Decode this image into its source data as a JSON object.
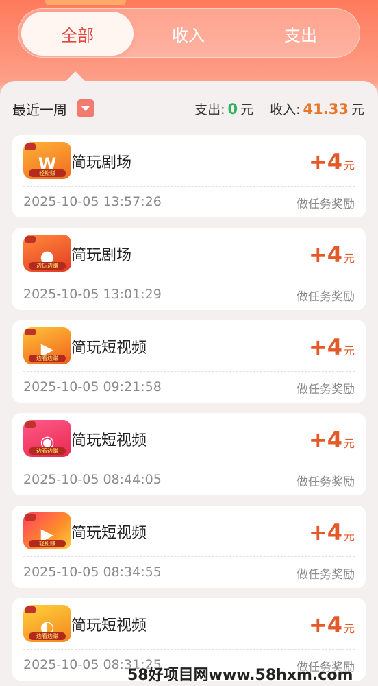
{
  "tabs": [
    {
      "label": "全部",
      "active": true
    },
    {
      "label": "收入",
      "active": false
    },
    {
      "label": "支出",
      "active": false
    }
  ],
  "summary": {
    "period": "最近一周",
    "expense_label": "支出:",
    "expense_value": "0",
    "income_label": "收入:",
    "income_value": "41.33",
    "unit": "元"
  },
  "records": [
    {
      "app": "简玩剧场",
      "amount": "+4",
      "unit": "元",
      "time": "2025-10-05 13:57:26",
      "desc": "做任务奖励",
      "icon": "app-icon-w",
      "icon_glyph": "W",
      "icon_strip": "轻松赚"
    },
    {
      "app": "简玩剧场",
      "amount": "+4",
      "unit": "元",
      "time": "2025-10-05 13:01:29",
      "desc": "做任务奖励",
      "icon": "app-icon-film",
      "icon_glyph": "●",
      "icon_strip": "边玩边赚"
    },
    {
      "app": "简玩短视频",
      "amount": "+4",
      "unit": "元",
      "time": "2025-10-05 09:21:58",
      "desc": "做任务奖励",
      "icon": "app-icon-play",
      "icon_glyph": "▶",
      "icon_strip": "边看边赚"
    },
    {
      "app": "简玩短视频",
      "amount": "+4",
      "unit": "元",
      "time": "2025-10-05 08:44:05",
      "desc": "做任务奖励",
      "icon": "app-icon-play-circle",
      "icon_glyph": "◉",
      "icon_strip": "边看边赚"
    },
    {
      "app": "简玩短视频",
      "amount": "+4",
      "unit": "元",
      "time": "2025-10-05 08:34:55",
      "desc": "做任务奖励",
      "icon": "app-icon-play-color",
      "icon_glyph": "▶",
      "icon_strip": "轻松赚"
    },
    {
      "app": "简玩短视频",
      "amount": "+4",
      "unit": "元",
      "time": "2025-10-05 08:31:25",
      "desc": "做任务奖励",
      "icon": "app-icon-play-yellow",
      "icon_glyph": "◐",
      "icon_strip": "边看边赚"
    }
  ],
  "watermark": "58好项目网www.58hxm.com"
}
